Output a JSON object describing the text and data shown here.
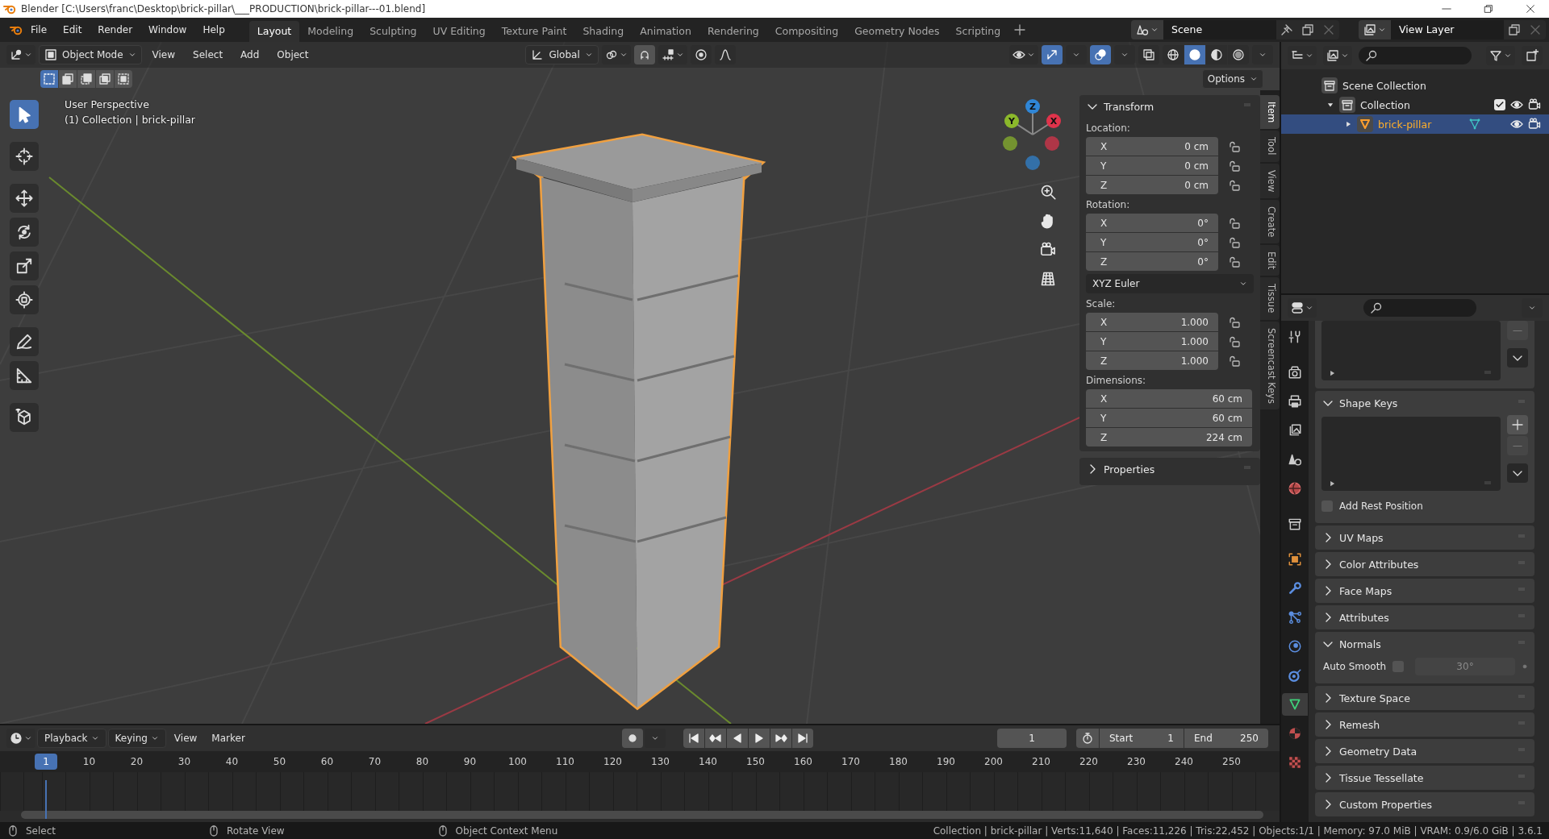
{
  "window": {
    "title": "Blender [C:\\Users\\franc\\Desktop\\brick-pillar\\___PRODUCTION\\brick-pillar---01.blend]"
  },
  "menu_bar": {
    "menus": [
      "File",
      "Edit",
      "Render",
      "Window",
      "Help"
    ],
    "workspaces": [
      {
        "label": "Layout",
        "selected": true
      },
      {
        "label": "Modeling",
        "selected": false
      },
      {
        "label": "Sculpting",
        "selected": false
      },
      {
        "label": "UV Editing",
        "selected": false
      },
      {
        "label": "Texture Paint",
        "selected": false
      },
      {
        "label": "Shading",
        "selected": false
      },
      {
        "label": "Animation",
        "selected": false
      },
      {
        "label": "Rendering",
        "selected": false
      },
      {
        "label": "Compositing",
        "selected": false
      },
      {
        "label": "Geometry Nodes",
        "selected": false
      },
      {
        "label": "Scripting",
        "selected": false
      }
    ],
    "scene": "Scene",
    "view_layer": "View Layer"
  },
  "viewport": {
    "header": {
      "mode": "Object Mode",
      "menus": [
        "View",
        "Select",
        "Add",
        "Object"
      ],
      "orientation": "Global",
      "gizmos_on": true,
      "overlays_on": true,
      "shading": [
        {
          "kind": "wireframe",
          "selected": false
        },
        {
          "kind": "solid",
          "selected": true
        },
        {
          "kind": "material",
          "selected": false
        },
        {
          "kind": "rendered",
          "selected": false
        }
      ]
    },
    "select_modes": [
      {
        "selected": true
      },
      {
        "selected": false
      },
      {
        "selected": false
      },
      {
        "selected": false
      },
      {
        "selected": false
      }
    ],
    "options": "Options",
    "tools": [
      {
        "kind": "select",
        "selected": true
      },
      {
        "kind": "cursor",
        "selected": false
      },
      {
        "kind": "move",
        "selected": false
      },
      {
        "kind": "rotate",
        "selected": false
      },
      {
        "kind": "scale",
        "selected": false
      },
      {
        "kind": "transform",
        "selected": false
      },
      {
        "kind": "annotate",
        "selected": false
      },
      {
        "kind": "measure",
        "selected": false
      },
      {
        "kind": "add_cube",
        "selected": false
      }
    ],
    "overlay_text": [
      "User Perspective",
      "(1) Collection | brick-pillar"
    ],
    "axes": [
      {
        "label": "Y",
        "color": "#8bb82b"
      },
      {
        "label": "Z",
        "color": "#2f86d6"
      },
      {
        "label": "X",
        "color": "#e0334b"
      }
    ],
    "sidebar": {
      "tabs": [
        {
          "label": "Item",
          "selected": true
        },
        {
          "label": "Tool",
          "selected": false
        },
        {
          "label": "View",
          "selected": false
        },
        {
          "label": "Create",
          "selected": false
        },
        {
          "label": "Edit",
          "selected": false
        },
        {
          "label": "Tissue",
          "selected": false
        },
        {
          "label": "Screencast Keys",
          "selected": false
        }
      ],
      "panels": [
        {
          "title": "Transform",
          "expanded": true,
          "groups": [
            {
              "label": "Location:",
              "locks": true,
              "fields": [
                {
                  "axis": "X",
                  "value": "0 cm"
                },
                {
                  "axis": "Y",
                  "value": "0 cm"
                },
                {
                  "axis": "Z",
                  "value": "0 cm"
                }
              ]
            },
            {
              "label": "Rotation:",
              "locks": true,
              "fields": [
                {
                  "axis": "X",
                  "value": "0°"
                },
                {
                  "axis": "Y",
                  "value": "0°"
                },
                {
                  "axis": "Z",
                  "value": "0°"
                }
              ],
              "mode": "XYZ Euler"
            },
            {
              "label": "Scale:",
              "locks": true,
              "fields": [
                {
                  "axis": "X",
                  "value": "1.000"
                },
                {
                  "axis": "Y",
                  "value": "1.000"
                },
                {
                  "axis": "Z",
                  "value": "1.000"
                }
              ]
            },
            {
              "label": "Dimensions:",
              "locks": false,
              "fields": [
                {
                  "axis": "X",
                  "value": "60 cm"
                },
                {
                  "axis": "Y",
                  "value": "60 cm"
                },
                {
                  "axis": "Z",
                  "value": "224 cm"
                }
              ]
            }
          ]
        },
        {
          "title": "Properties",
          "expanded": false
        }
      ]
    }
  },
  "outliner": {
    "tree": [
      {
        "label": "Scene Collection",
        "kind": "scene_collection",
        "selected": false,
        "children": [
          {
            "label": "Collection",
            "kind": "collection",
            "expanded": true,
            "checked": true,
            "selected": false,
            "children": [
              {
                "label": "brick-pillar",
                "kind": "mesh",
                "expanded": false,
                "selected": true
              }
            ]
          }
        ]
      }
    ]
  },
  "properties": {
    "tabs": [
      {
        "kind": "tool",
        "selected": false
      },
      {
        "kind": "render",
        "selected": false
      },
      {
        "kind": "output",
        "selected": false
      },
      {
        "kind": "view_layer",
        "selected": false
      },
      {
        "kind": "scene",
        "selected": false
      },
      {
        "kind": "world",
        "selected": false
      },
      {
        "kind": "collection",
        "selected": false
      },
      {
        "kind": "object",
        "selected": false
      },
      {
        "kind": "modifiers",
        "selected": false
      },
      {
        "kind": "particles",
        "selected": false
      },
      {
        "kind": "physics",
        "selected": false
      },
      {
        "kind": "constraints",
        "selected": false
      },
      {
        "kind": "data",
        "selected": true
      },
      {
        "kind": "material",
        "selected": false
      },
      {
        "kind": "texture",
        "selected": false
      }
    ],
    "panels": [
      {
        "kind": "list"
      },
      {
        "kind": "panel",
        "title": "Shape Keys",
        "expanded": true,
        "list": true,
        "rest_position": {
          "label": "Add Rest Position",
          "checked": false
        }
      },
      {
        "kind": "panel",
        "title": "UV Maps",
        "expanded": false
      },
      {
        "kind": "panel",
        "title": "Color Attributes",
        "expanded": false
      },
      {
        "kind": "panel",
        "title": "Face Maps",
        "expanded": false
      },
      {
        "kind": "panel",
        "title": "Attributes",
        "expanded": false
      },
      {
        "kind": "panel",
        "title": "Normals",
        "expanded": true,
        "auto_smooth": {
          "label": "Auto Smooth",
          "checked": false,
          "angle": "30°",
          "disabled": true
        }
      },
      {
        "kind": "panel",
        "title": "Texture Space",
        "expanded": false
      },
      {
        "kind": "panel",
        "title": "Remesh",
        "expanded": false
      },
      {
        "kind": "panel",
        "title": "Geometry Data",
        "expanded": false
      },
      {
        "kind": "panel",
        "title": "Tissue Tessellate",
        "expanded": false
      },
      {
        "kind": "panel",
        "title": "Custom Properties",
        "expanded": false
      }
    ]
  },
  "timeline": {
    "menus": [
      {
        "label": "Playback",
        "dropdown": true
      },
      {
        "label": "Keying",
        "dropdown": true
      },
      {
        "label": "View",
        "dropdown": false
      },
      {
        "label": "Marker",
        "dropdown": false
      }
    ],
    "frame": "1",
    "start": {
      "label": "Start",
      "value": "1"
    },
    "end": {
      "label": "End",
      "value": "250"
    },
    "current_frame": "1",
    "ticks": [
      "10",
      "20",
      "30",
      "40",
      "50",
      "60",
      "70",
      "80",
      "90",
      "100",
      "110",
      "120",
      "130",
      "140",
      "150",
      "160",
      "170",
      "180",
      "190",
      "200",
      "210",
      "220",
      "230",
      "240",
      "250"
    ]
  },
  "status_bar": {
    "hints": [
      "Select",
      "Rotate View",
      "Object Context Menu"
    ],
    "stats": "Collection | brick-pillar | Verts:11,640 | Faces:11,226 | Tris:22,452 | Objects:1/1 | Memory: 97.0 MiB | VRAM: 0.9/6.0 GiB | 3.6.1"
  }
}
